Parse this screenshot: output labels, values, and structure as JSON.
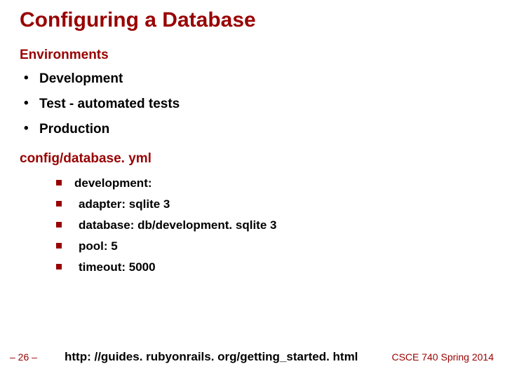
{
  "title": "Configuring a Database",
  "section1": {
    "label": "Environments",
    "items": [
      "Development",
      "Test  - automated tests",
      "Production"
    ]
  },
  "section2": {
    "label": "config/database. yml",
    "items": [
      "development:",
      " adapter: sqlite 3",
      " database: db/development. sqlite 3",
      " pool: 5",
      " timeout: 5000"
    ]
  },
  "footer": {
    "page": "– 26 –",
    "url": "http: //guides. rubyonrails. org/getting_started. html",
    "course": "CSCE 740 Spring 2014"
  }
}
